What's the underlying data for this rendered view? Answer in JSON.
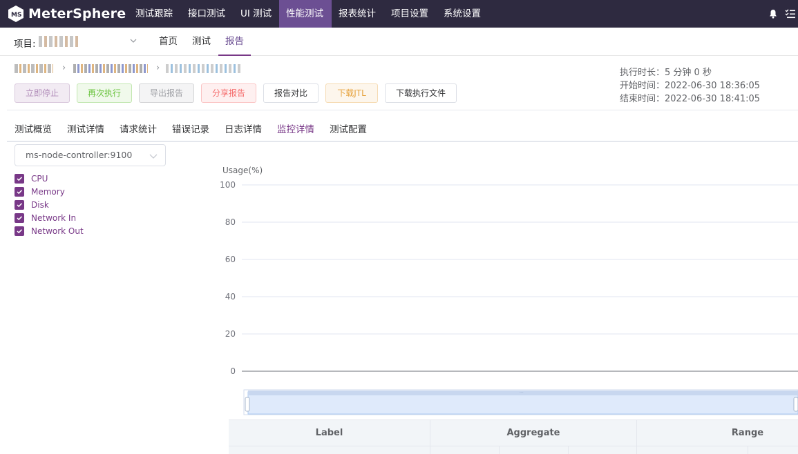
{
  "app": {
    "name": "MeterSphere"
  },
  "nav": {
    "items": [
      {
        "label": "测试跟踪"
      },
      {
        "label": "接口测试"
      },
      {
        "label": "UI 测试"
      },
      {
        "label": "性能测试",
        "active": true
      },
      {
        "label": "报表统计"
      },
      {
        "label": "项目设置"
      },
      {
        "label": "系统设置"
      }
    ],
    "icons": [
      "bell-icon",
      "task-list-icon"
    ]
  },
  "subheader": {
    "project_label": "项目:",
    "tabs": [
      {
        "label": "首页"
      },
      {
        "label": "测试"
      },
      {
        "label": "报告",
        "active": true
      }
    ]
  },
  "report": {
    "actions": {
      "stop": "立即停止",
      "rerun": "再次执行",
      "export": "导出报告",
      "share": "分享报告",
      "compare": "报告对比",
      "download_jtl": "下载JTL",
      "download_files": "下载执行文件"
    },
    "meta": {
      "duration": "执行时长：5 分钟 0 秒",
      "start": "开始时间：2022-06-30 18:36:05",
      "end": "结束时间：2022-06-30 18:41:05"
    },
    "tabs": [
      {
        "label": "测试概览"
      },
      {
        "label": "测试详情"
      },
      {
        "label": "请求统计"
      },
      {
        "label": "错误记录"
      },
      {
        "label": "日志详情"
      },
      {
        "label": "监控详情",
        "active": true
      },
      {
        "label": "测试配置"
      }
    ]
  },
  "monitor": {
    "selected_node": "ms-node-controller:9100",
    "metrics": [
      {
        "label": "CPU",
        "checked": true
      },
      {
        "label": "Memory",
        "checked": true
      },
      {
        "label": "Disk",
        "checked": true
      },
      {
        "label": "Network In",
        "checked": true
      },
      {
        "label": "Network Out",
        "checked": true
      }
    ]
  },
  "chart_data": {
    "type": "line",
    "ylabel": "Usage(%)",
    "ylim": [
      0,
      100
    ],
    "yticks": [
      "100",
      "80",
      "60",
      "40",
      "20",
      "0"
    ],
    "series": [],
    "grid": true,
    "has_zoom_slider": true
  },
  "table": {
    "headers": [
      "Label",
      "Aggregate",
      "Range"
    ]
  },
  "colors": {
    "nav_bg": "#2e2a40",
    "accent": "#783887",
    "active_nav": "#6c4f93"
  }
}
